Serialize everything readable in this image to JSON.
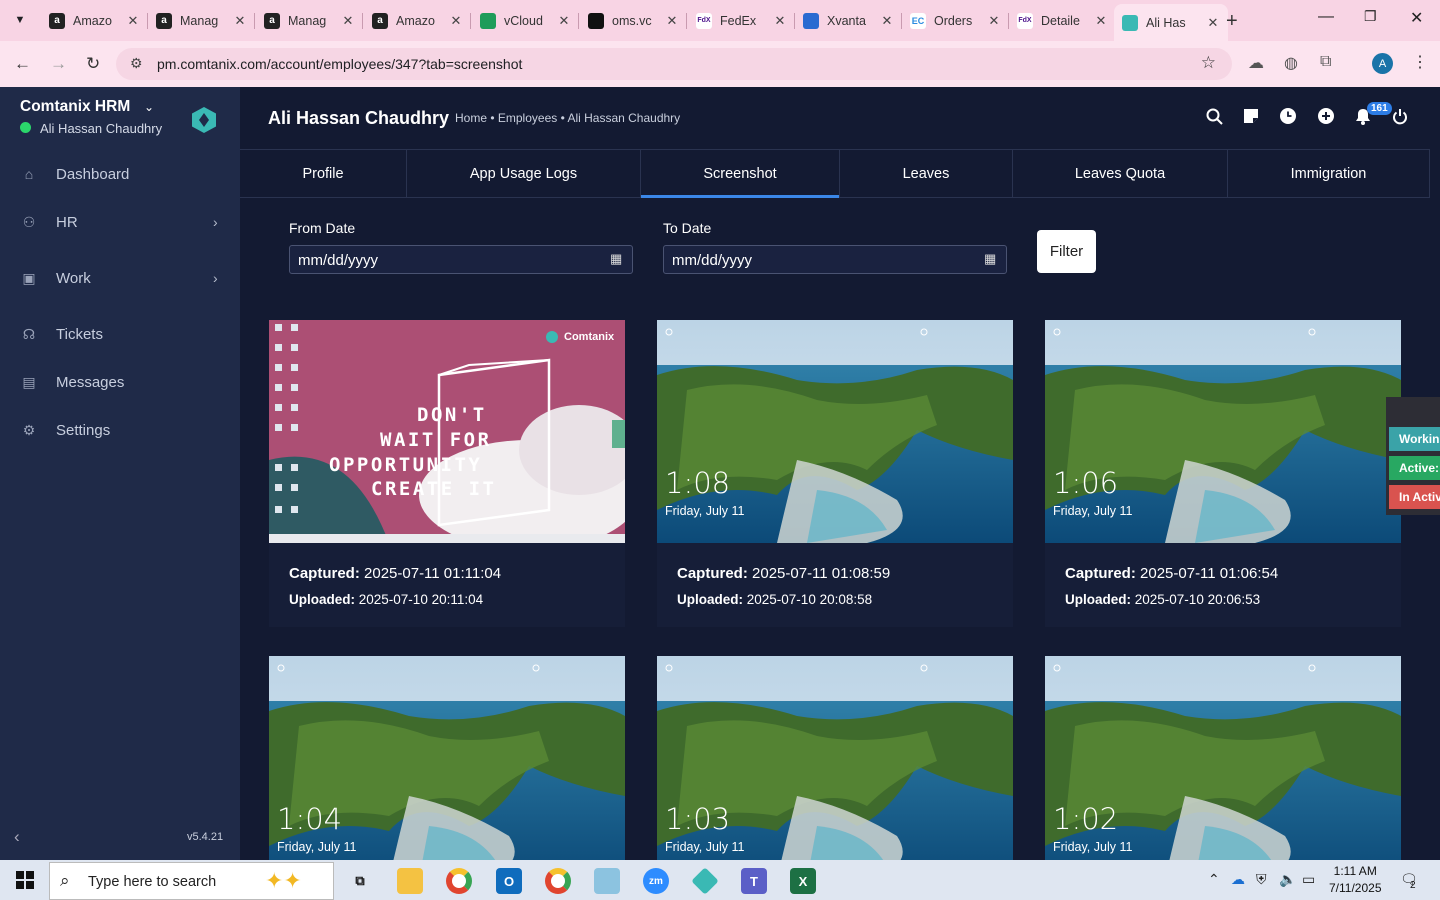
{
  "browser": {
    "tabs": [
      {
        "title": "Amazo",
        "icon": "amazon-icon"
      },
      {
        "title": "Manag",
        "icon": "amazon-icon"
      },
      {
        "title": "Manag",
        "icon": "amazon-icon"
      },
      {
        "title": "Amazo",
        "icon": "amazon-icon"
      },
      {
        "title": "vCloud",
        "icon": "sheets-icon"
      },
      {
        "title": "oms.vc",
        "icon": "oms-icon"
      },
      {
        "title": "FedEx",
        "icon": "fedex-icon"
      },
      {
        "title": "Xvanta",
        "icon": "xvanta-icon"
      },
      {
        "title": "Orders",
        "icon": "ec-icon"
      },
      {
        "title": "Detaile",
        "icon": "fedex-icon"
      },
      {
        "title": "Ali Has",
        "icon": "comtanix-icon",
        "active": true
      }
    ],
    "url": "pm.comtanix.com/account/employees/347?tab=screenshot",
    "profile_initial": "A"
  },
  "sidebar": {
    "brand": "Comtanix HRM",
    "user": "Ali Hassan Chaudhry",
    "items": [
      {
        "label": "Dashboard",
        "icon": "home-icon"
      },
      {
        "label": "HR",
        "icon": "users-icon",
        "has_children": true
      },
      {
        "label": "Work",
        "icon": "briefcase-icon",
        "has_children": true
      },
      {
        "label": "Tickets",
        "icon": "headset-icon"
      },
      {
        "label": "Messages",
        "icon": "message-icon"
      },
      {
        "label": "Settings",
        "icon": "gear-icon"
      }
    ],
    "version": "v5.4.21"
  },
  "header": {
    "title": "Ali Hassan Chaudhry",
    "breadcrumb": "Home • Employees • Ali Hassan Chaudhry",
    "notification_count": "161"
  },
  "profile_tabs": [
    "Profile",
    "App Usage Logs",
    "Screenshot",
    "Leaves",
    "Leaves Quota",
    "Immigration"
  ],
  "active_tab": "Screenshot",
  "filter": {
    "from_label": "From Date",
    "to_label": "To Date",
    "from_placeholder": "mm/dd/yyyy",
    "to_placeholder": "mm/dd/yyyy",
    "button": "Filter"
  },
  "screenshots": [
    {
      "captured_label": "Captured:",
      "captured": "2025-07-11 01:11:04",
      "uploaded_label": "Uploaded:",
      "uploaded": "2025-07-10 20:11:04",
      "type": "desktop",
      "overlay_brand": "Comtanix",
      "overlay_text": [
        "DON'T",
        "WAIT FOR",
        "OPPORTUNITY",
        "CREATE IT"
      ]
    },
    {
      "captured_label": "Captured:",
      "captured": "2025-07-11 01:08:59",
      "uploaded_label": "Uploaded:",
      "uploaded": "2025-07-10 20:08:58",
      "type": "lock",
      "time": "1:08",
      "date": "Friday, July 11"
    },
    {
      "captured_label": "Captured:",
      "captured": "2025-07-11 01:06:54",
      "uploaded_label": "Uploaded:",
      "uploaded": "2025-07-10 20:06:53",
      "type": "lock",
      "time": "1:06",
      "date": "Friday, July 11"
    },
    {
      "type": "lock",
      "time": "1:04",
      "date": "Friday, July 11"
    },
    {
      "type": "lock",
      "time": "1:03",
      "date": "Friday, July 11"
    },
    {
      "type": "lock",
      "time": "1:02",
      "date": "Friday, July 11"
    }
  ],
  "status_tabs": [
    {
      "label": "Workin",
      "color": "#3aa3a8"
    },
    {
      "label": "Active:",
      "color": "#28a862"
    },
    {
      "label": "In Activ",
      "color": "#d9534f"
    }
  ],
  "taskbar": {
    "search_placeholder": "Type here to search",
    "time": "1:11 AM",
    "date": "7/11/2025",
    "notification_count": "2"
  }
}
